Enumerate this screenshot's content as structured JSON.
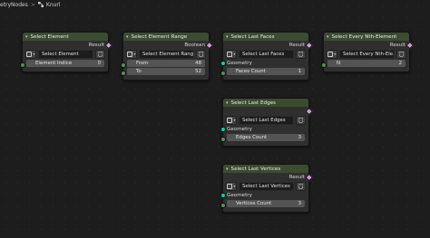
{
  "breadcrumb": {
    "tree": "etryNodes",
    "separator": ">",
    "node_group": "Knurl"
  },
  "colors": {
    "header": "#3b4c30",
    "geometry_socket": "#00d6a3",
    "boolean_socket": "#cfa0d8",
    "integer_socket": "#598c5c"
  },
  "nodes": {
    "select_element": {
      "title": "Select Element",
      "outputs": [
        "Result"
      ],
      "selector_name": "Select Element",
      "fields": [
        {
          "label": "Element Indice",
          "value": "0"
        }
      ]
    },
    "select_element_range": {
      "title": "Select Element Range",
      "outputs": [
        "Boolean"
      ],
      "selector_name": "Select Element Range",
      "fields": [
        {
          "label": "From",
          "value": "48"
        },
        {
          "label": "To",
          "value": "52"
        }
      ]
    },
    "select_last_faces": {
      "title": "Select Last Faces",
      "outputs": [
        "Result"
      ],
      "selector_name": "Select Last Faces",
      "inputs": [
        "Geometry"
      ],
      "fields": [
        {
          "label": "Faces Count",
          "value": "1"
        }
      ]
    },
    "select_every_nth": {
      "title": "Select Every Nth-Element",
      "outputs": [
        "Result"
      ],
      "selector_name": "Select Every Nth-Ele...",
      "fields": [
        {
          "label": "N",
          "value": "2"
        }
      ]
    },
    "select_last_edges": {
      "title": "Select Last Edges",
      "selector_name": "Select Last Edges",
      "inputs": [
        "Geometry"
      ],
      "fields": [
        {
          "label": "Edges Count",
          "value": "3"
        }
      ]
    },
    "select_last_vertices": {
      "title": "Select Last Vertices",
      "outputs": [
        "Result"
      ],
      "selector_name": "Select Last Vertices",
      "inputs": [
        "Geometry"
      ],
      "fields": [
        {
          "label": "Vertices Count",
          "value": "3"
        }
      ]
    }
  }
}
